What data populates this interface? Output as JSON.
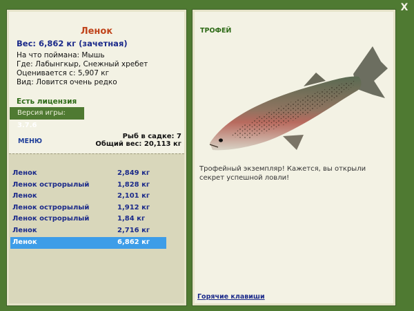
{
  "window": {
    "close_label": "X"
  },
  "catch": {
    "title": "Ленок",
    "weight_line": "Вес: 6,862 кг (зачетная)",
    "bait_line": "На что поймана: Мышь",
    "location_line": "Где: Лабынгкыр, Снежный хребет",
    "rated_line": "Оценивается с: 5,907 кг",
    "kind_line": "Вид: Ловится очень редко"
  },
  "license": {
    "label": "Есть лицензия"
  },
  "version": {
    "label": "Версия игры:",
    "value": "3.7.6"
  },
  "menu": {
    "label": "МЕНЮ"
  },
  "keepnet": {
    "count_line": "Рыб в садке: 7",
    "total_line": "Общий вес: 20,113 кг"
  },
  "fish_list": [
    {
      "name": "Ленок",
      "weight": "2,849 кг",
      "selected": false
    },
    {
      "name": "Ленок острорылый",
      "weight": "1,828 кг",
      "selected": false
    },
    {
      "name": "Ленок",
      "weight": "2,101 кг",
      "selected": false
    },
    {
      "name": "Ленок острорылый",
      "weight": "1,912 кг",
      "selected": false
    },
    {
      "name": "Ленок острорылый",
      "weight": "1,84 кг",
      "selected": false
    },
    {
      "name": "Ленок",
      "weight": "2,716 кг",
      "selected": false
    },
    {
      "name": "Ленок",
      "weight": "6,862 кг",
      "selected": true
    }
  ],
  "trophy": {
    "label": "ТРОФЕЙ",
    "description": "Трофейный экземпляр! Кажется, вы открыли секрет успешной ловли!"
  },
  "footer": {
    "hotkeys_label": "Горячие клавиши"
  },
  "colors": {
    "background": "#4f7a32",
    "panel": "#f3f2e4",
    "title": "#c0441b",
    "link": "#1b2a8a",
    "selected_row": "#3d9de8"
  }
}
